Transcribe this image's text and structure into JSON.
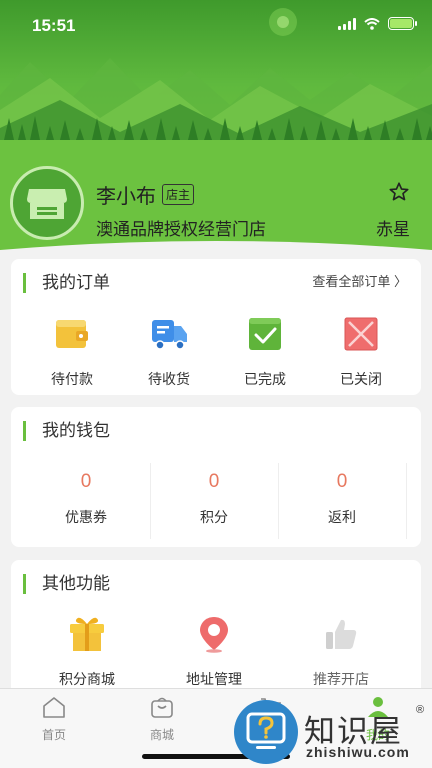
{
  "status_bar": {
    "time": "15:51"
  },
  "profile": {
    "name": "李小布",
    "badge": "店主",
    "store": "澳通品牌授权经营门店",
    "region": "赤星"
  },
  "orders": {
    "title": "我的订单",
    "view_all": "查看全部订单 〉",
    "items": [
      {
        "label": "待付款",
        "icon": "wallet-icon"
      },
      {
        "label": "待收货",
        "icon": "truck-icon"
      },
      {
        "label": "已完成",
        "icon": "check-icon"
      },
      {
        "label": "已关闭",
        "icon": "closed-icon"
      }
    ]
  },
  "wallet": {
    "title": "我的钱包",
    "items": [
      {
        "label": "优惠券",
        "value": "0"
      },
      {
        "label": "积分",
        "value": "0"
      },
      {
        "label": "返利",
        "value": "0"
      }
    ]
  },
  "functions": {
    "title": "其他功能",
    "items": [
      {
        "label": "积分商城",
        "icon": "gift-icon"
      },
      {
        "label": "地址管理",
        "icon": "location-pin-icon"
      },
      {
        "label": "推荐开店",
        "icon": "thumbs-up-icon"
      }
    ]
  },
  "tabbar": {
    "items": [
      {
        "label": "首页",
        "icon": "home-icon"
      },
      {
        "label": "商城",
        "icon": "shop-bag-icon"
      },
      {
        "label": "",
        "icon": "cart-icon"
      },
      {
        "label": "我的",
        "icon": "profile-icon"
      }
    ]
  },
  "watermark": {
    "text": "知识屋",
    "reg": "®",
    "url": "zhishiwu.com"
  },
  "colors": {
    "primary_green": "#6abf3e",
    "wallet_value": "#e7785f"
  }
}
